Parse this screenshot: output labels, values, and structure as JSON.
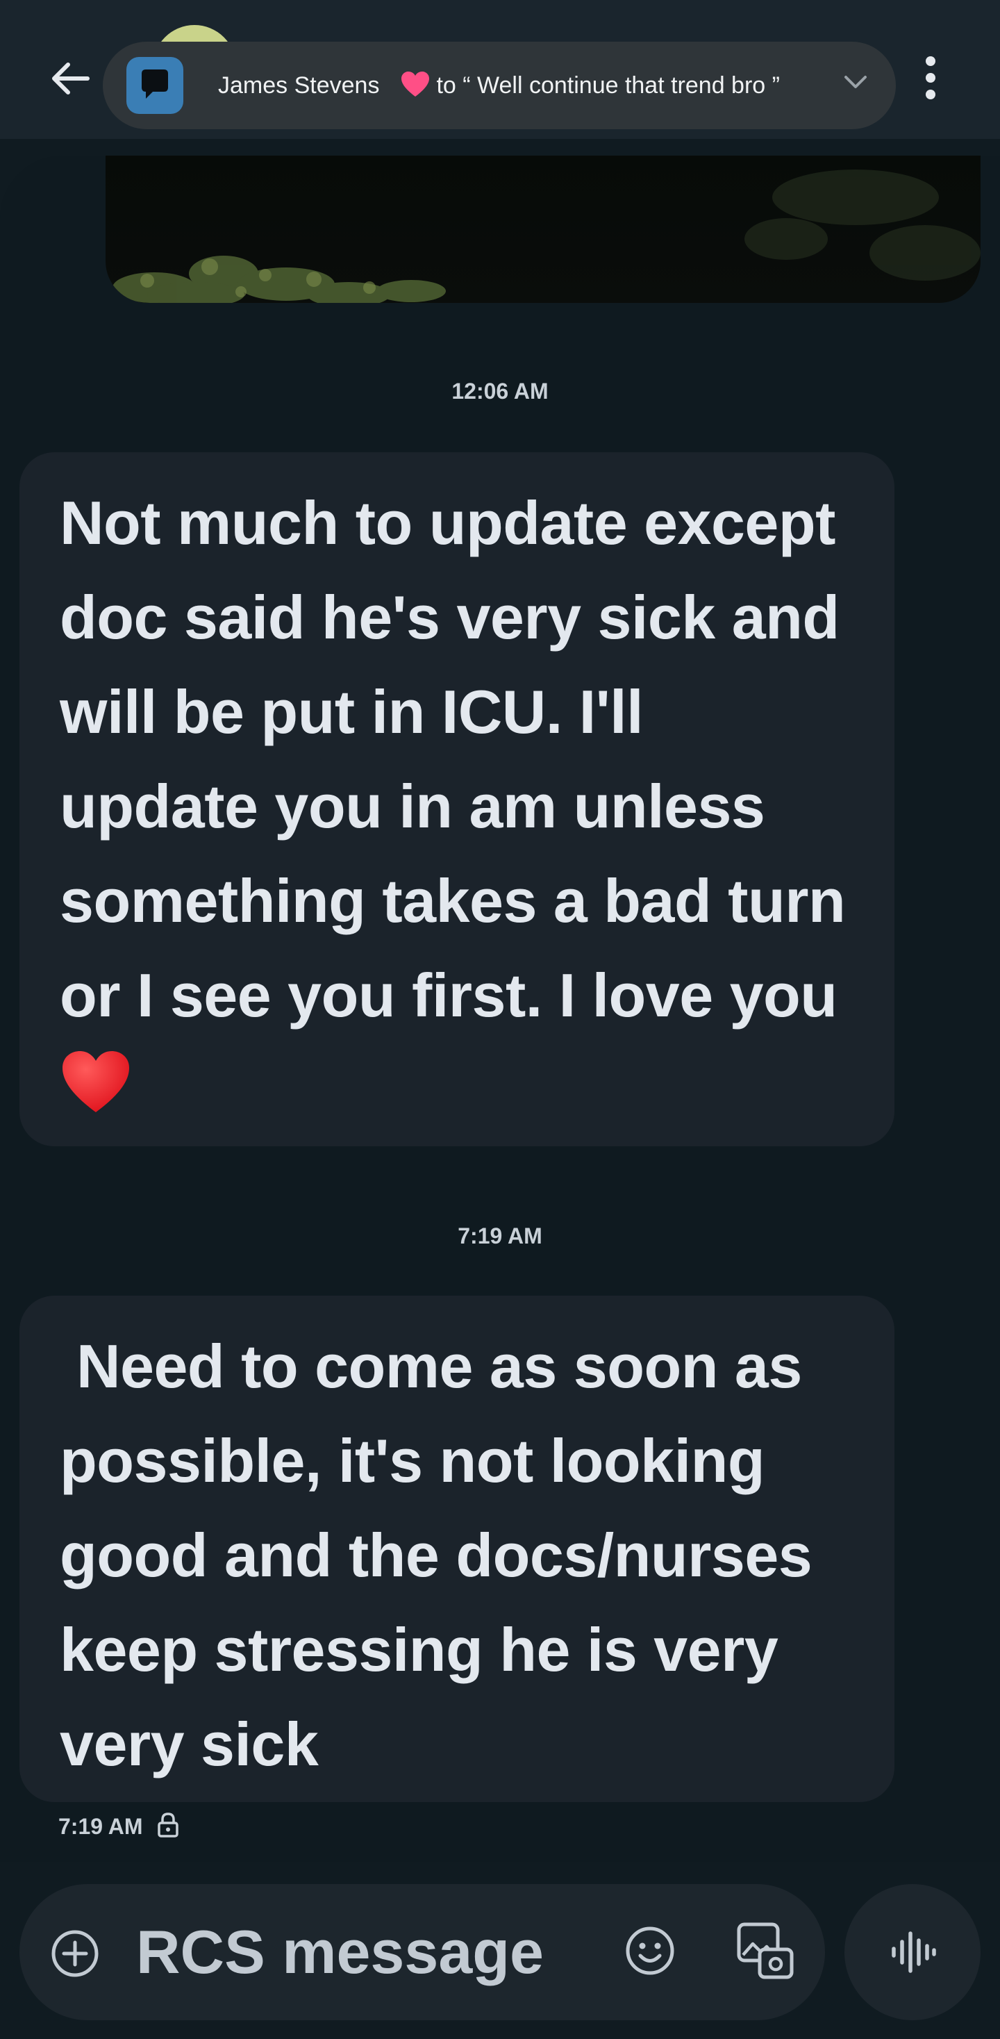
{
  "header": {
    "back_icon": "arrow-left-icon",
    "more_icon": "more-vert-icon",
    "notification": {
      "app_icon": "messages-app-icon",
      "sender": "James Stevens",
      "reaction": "heart-icon",
      "text": "to “ Well continue that trend bro ”",
      "chevron": "chevron-down-icon"
    }
  },
  "messages": [
    {
      "timestamp": "12:06 AM",
      "text": "Not much to update except doc said he's very sick and will be put in ICU. I'll update you in am unless something takes a bad turn or I see you first. I love you",
      "emoji": "red-heart-emoji"
    },
    {
      "timestamp": "7:19 AM",
      "text": " Need to come as soon as possible, it's not looking good and the docs/nurses keep stressing he is very very sick"
    }
  ],
  "status": {
    "time": "7:19 AM",
    "icon": "lock-icon"
  },
  "compose": {
    "placeholder": "RCS message",
    "add_icon": "add-circle-icon",
    "emoji_icon": "emoji-icon",
    "media_icon": "gallery-icon",
    "voice_icon": "voice-waveform-icon"
  },
  "colors": {
    "background": "#101b21",
    "bubble": "#1b232b",
    "text": "#e3e8ee",
    "notification_pill": "#2f3539",
    "app_icon": "#3a7eb5",
    "heart": "#ff2d3a"
  }
}
